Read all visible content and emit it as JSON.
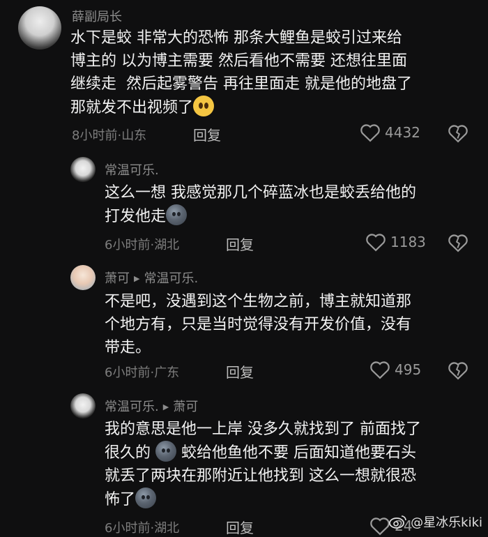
{
  "comments": [
    {
      "author": "薛副局长",
      "body_lines": [
        "水下是蛟 非常大的恐怖 那条大鲤鱼是蛟引过来给",
        "博主的 以为博主需要 然后看他不需要 还想往里面",
        "继续走  然后起雾警告 再往里面走 就是他的地盘了",
        "那就发不出视频了"
      ],
      "time": "8小时前",
      "location": "山东",
      "reply": "回复",
      "likes": "4432"
    },
    {
      "author": "常温可乐.",
      "body_lines": [
        "这么一想 我感觉那几个碎蓝冰也是蛟丢给他的",
        "打发他走"
      ],
      "time": "6小时前",
      "location": "湖北",
      "reply": "回复",
      "likes": "1183"
    },
    {
      "author": "萧可",
      "reply_to": "常温可乐.",
      "body_lines": [
        "不是吧，没遇到这个生物之前，博主就知道那",
        "个地方有，只是当时觉得没有开发价值，没有",
        "带走。"
      ],
      "time": "6小时前",
      "location": "广东",
      "reply": "回复",
      "likes": "495"
    },
    {
      "author": "常温可乐.",
      "reply_to": "萧可",
      "body_lines": [
        "我的意思是他一上岸 没多久就找到了 前面找了",
        "很久的",
        "蛟给他鱼他不要 后面知道他要石头",
        "就丢了两块在那附近让他找到 这么一想就很恐",
        "怖了"
      ],
      "time": "6小时前",
      "location": "湖北",
      "reply": "回复",
      "likes": "24"
    }
  ],
  "separator": "·",
  "watermark": "@星冰乐kiki"
}
